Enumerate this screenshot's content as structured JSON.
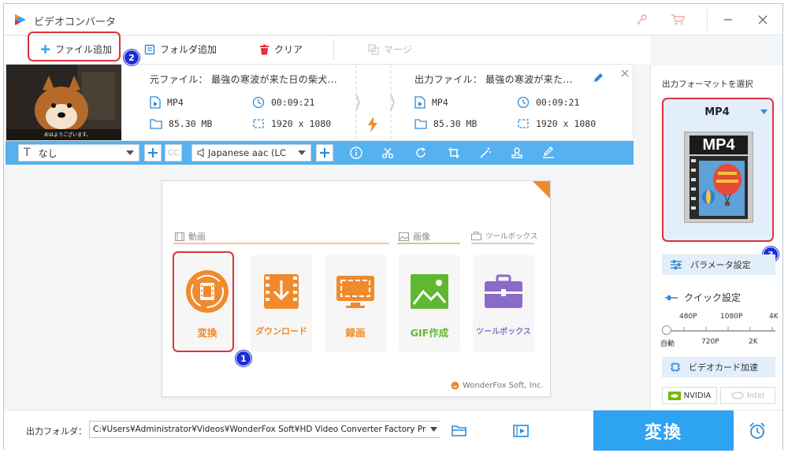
{
  "app": {
    "title": "ビデオコンバータ"
  },
  "toolbar": {
    "add_file": "ファイル追加",
    "add_folder": "フォルダ追加",
    "clear": "クリア",
    "merge": "マージ"
  },
  "file": {
    "source_label": "元ファイル：",
    "source_name": "最強の寒波が来た日の柴犬...",
    "output_label": "出力ファイル：",
    "output_name": "最強の寒波が来た...",
    "src_format": "MP4",
    "src_duration": "00:09:21",
    "src_size": "85.30 MB",
    "src_resolution": "1920 x 1080",
    "out_format": "MP4",
    "out_duration": "00:09:21",
    "out_size": "85.30 MB",
    "out_resolution": "1920 x 1080",
    "thumb_caption": "おはようございます。"
  },
  "editbar": {
    "subtitle": "なし",
    "cc": "CC",
    "audio": "Japanese aac (LC"
  },
  "home": {
    "section_video": "動画",
    "section_image": "画像",
    "section_toolbox": "ツールボックス",
    "tiles": [
      {
        "label": "変換",
        "color": "#f08a2c"
      },
      {
        "label": "ダウンロード",
        "color": "#f08a2c"
      },
      {
        "label": "録画",
        "color": "#f08a2c"
      },
      {
        "label": "GIF作成",
        "color": "#5fb82f"
      },
      {
        "label": "ツールボックス",
        "color": "#8a6bc8"
      }
    ],
    "brand": "WonderFox Soft, Inc."
  },
  "right": {
    "format_title": "出力フォーマットを選択",
    "format_value": "MP4",
    "format_image_text": "MP4",
    "param_button": "パラメータ設定",
    "quick_title": "クイック設定",
    "quick_top": [
      "480P",
      "1080P",
      "4K"
    ],
    "quick_bottom": [
      "自動",
      "720P",
      "2K"
    ],
    "gpu_title": "ビデオカード加速",
    "nvidia": "NVIDIA",
    "intel": "Intel"
  },
  "bottom": {
    "output_label": "出力フォルダ：",
    "path": "C:¥Users¥Administrator¥Videos¥WonderFox Soft¥HD Video Converter Factory Pro¥OutputVideo¥",
    "convert": "変換"
  },
  "badges": [
    "1",
    "2",
    "3"
  ],
  "colors": {
    "accent": "#2ea3f2",
    "highlight": "#e0333a",
    "badge": "#1b2ed6"
  }
}
